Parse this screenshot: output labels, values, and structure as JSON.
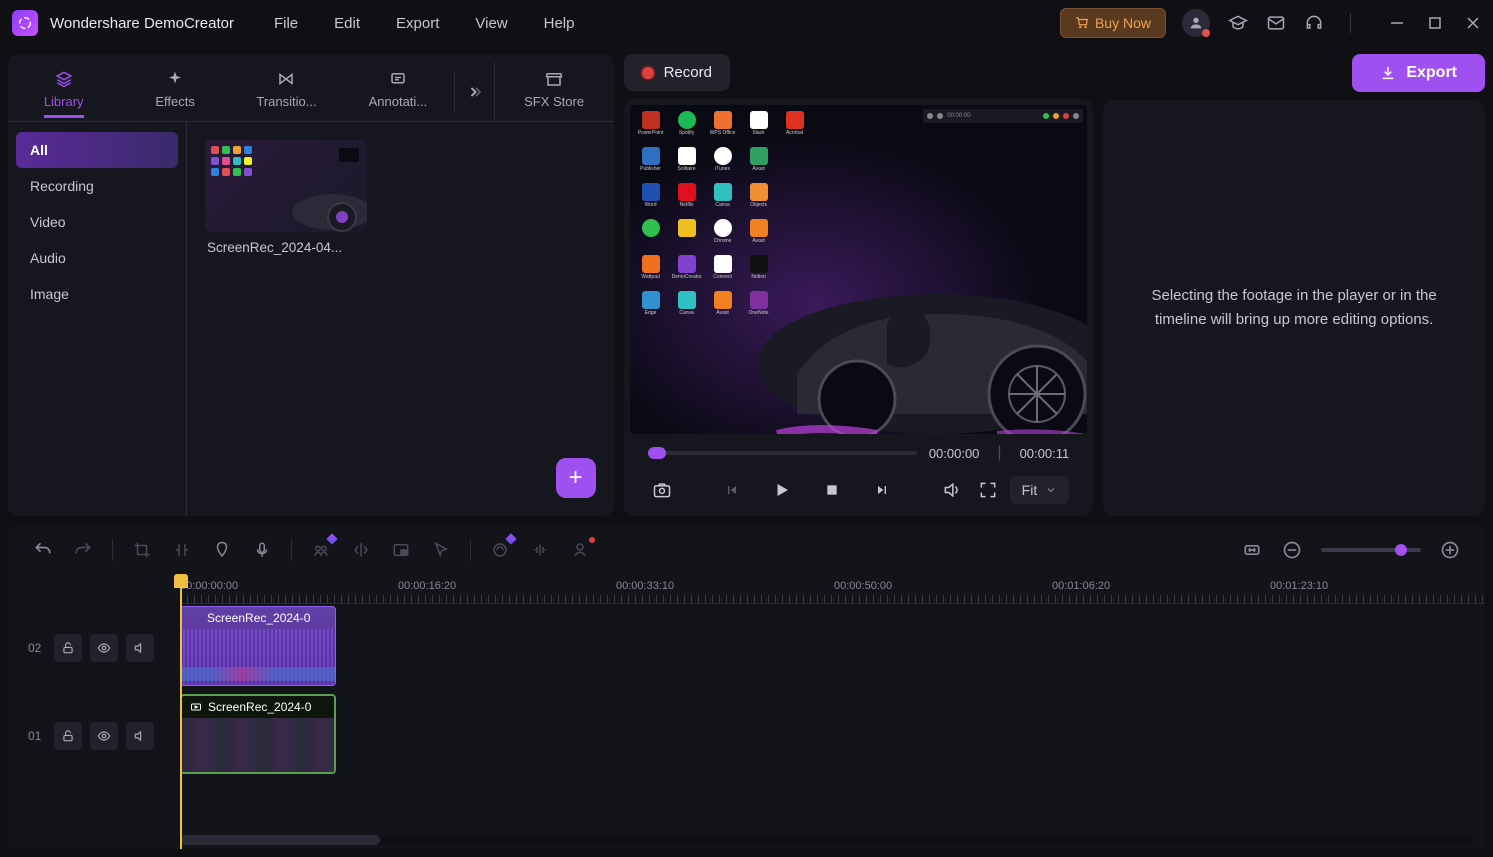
{
  "app": {
    "title": "Wondershare DemoCreator"
  },
  "menubar": [
    "File",
    "Edit",
    "Export",
    "View",
    "Help"
  ],
  "titlebar": {
    "buy_now": "Buy Now"
  },
  "library_tabs": {
    "items": [
      {
        "label": "Library",
        "icon": "layers"
      },
      {
        "label": "Effects",
        "icon": "sparkle"
      },
      {
        "label": "Transitio...",
        "icon": "transition"
      },
      {
        "label": "Annotati...",
        "icon": "annotation"
      }
    ],
    "sfx": "SFX Store"
  },
  "library_sidebar": [
    "All",
    "Recording",
    "Video",
    "Audio",
    "Image"
  ],
  "media": [
    {
      "name": "ScreenRec_2024-04..."
    }
  ],
  "record_button": "Record",
  "export_button": "Export",
  "preview": {
    "current_time": "00:00:00",
    "total_time": "00:00:11",
    "fit_label": "Fit"
  },
  "inspector": {
    "hint": "Selecting the footage in the player or in the timeline will bring up more editing options."
  },
  "timeline": {
    "ruler": [
      "00:00:00:00",
      "00:00:16:20",
      "00:00:33:10",
      "00:00:50:00",
      "00:01:06:20",
      "00:01:23:10"
    ],
    "tracks": [
      {
        "num": "02",
        "clip_label": "ScreenRec_2024-0",
        "type": "audio"
      },
      {
        "num": "01",
        "clip_label": "ScreenRec_2024-0",
        "type": "video"
      }
    ]
  }
}
